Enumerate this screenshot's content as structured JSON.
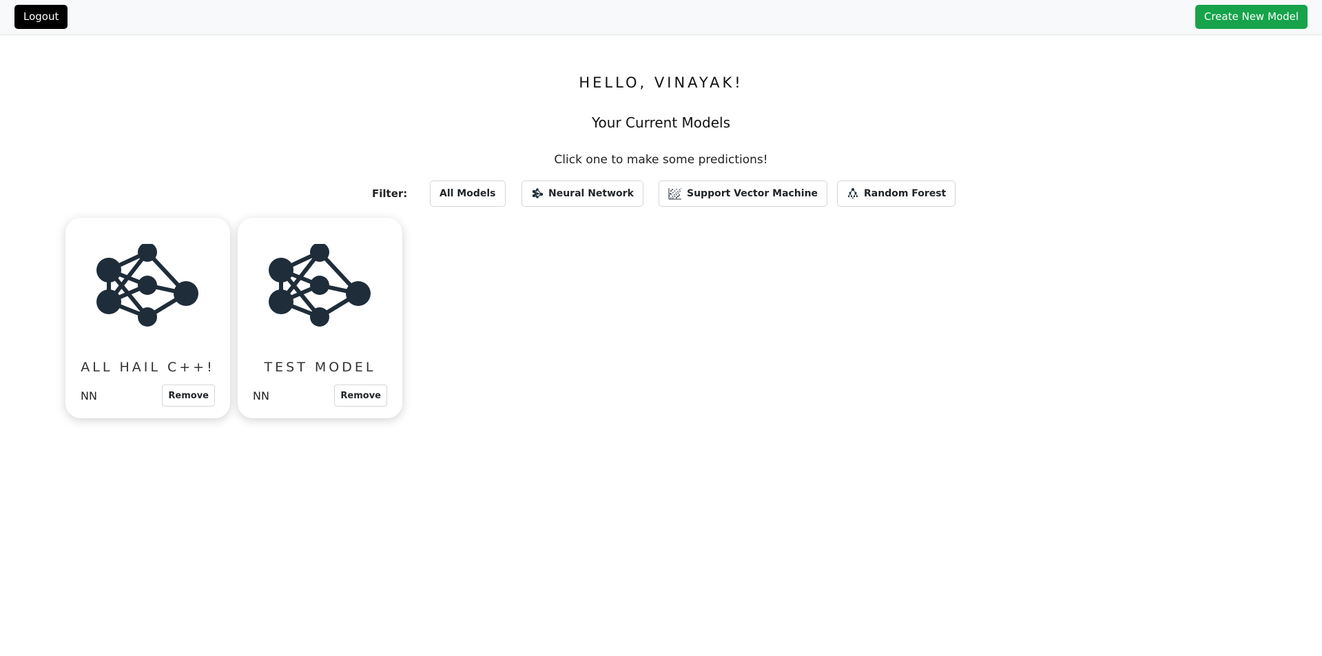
{
  "header": {
    "logout_label": "Logout",
    "create_label": "Create New Model"
  },
  "main": {
    "greeting": "HELLO, VINAYAK!",
    "subtitle": "Your Current Models",
    "hint": "Click one to make some predictions!"
  },
  "filter": {
    "label": "Filter:",
    "options": [
      {
        "label": "All Models",
        "icon": null
      },
      {
        "label": "Neural Network",
        "icon": "neural-network-icon"
      },
      {
        "label": "Support Vector Machine",
        "icon": "svm-icon"
      },
      {
        "label": "Random Forest",
        "icon": "random-forest-icon"
      }
    ]
  },
  "models": [
    {
      "name": "ALL HAIL C++!",
      "type": "NN",
      "icon": "neural-network-icon",
      "remove_label": "Remove"
    },
    {
      "name": "TEST MODEL",
      "type": "NN",
      "icon": "neural-network-icon",
      "remove_label": "Remove"
    }
  ],
  "colors": {
    "create_button": "#16a34a",
    "logout_button": "#000000",
    "icon_fill": "#1f2d3a"
  }
}
